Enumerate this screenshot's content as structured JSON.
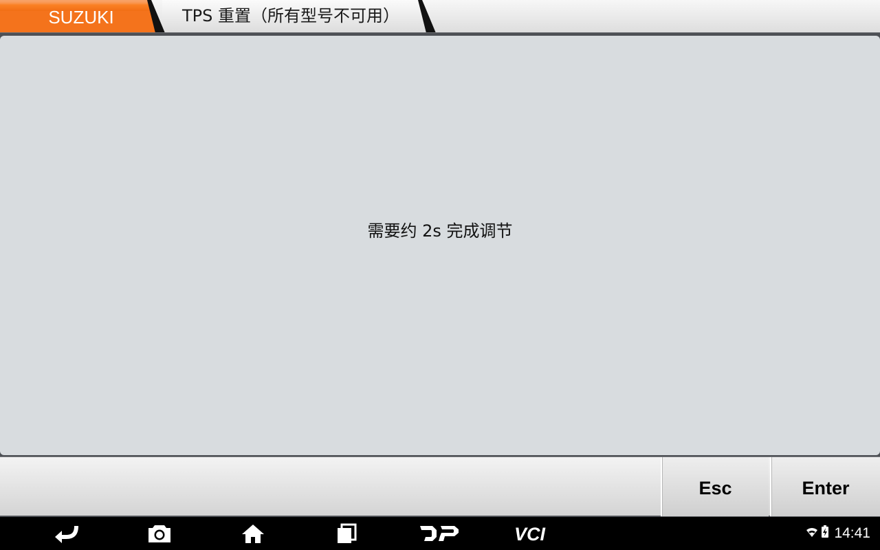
{
  "header": {
    "brand_label": "SUZUKI",
    "page_title": "TPS 重置（所有型号不可用）",
    "brand_color": "#f4731c"
  },
  "content": {
    "message": "需要约 2s 完成调节"
  },
  "buttons": {
    "esc_label": "Esc",
    "enter_label": "Enter"
  },
  "nav_bar": {
    "icons": [
      "back-icon",
      "camera-icon",
      "home-icon",
      "recent-apps-icon",
      "dp-icon",
      "vci-icon"
    ]
  },
  "status": {
    "wifi_icon": "wifi-icon",
    "battery_icon": "battery-charging-icon",
    "time": "14:41"
  }
}
